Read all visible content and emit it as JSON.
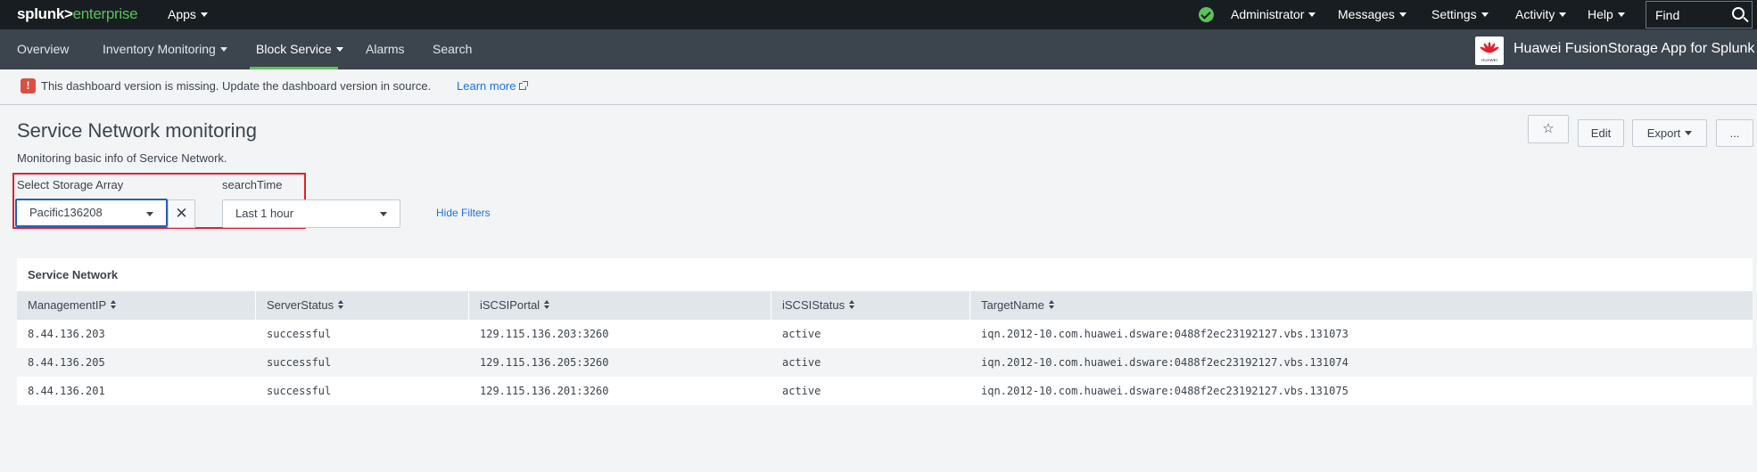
{
  "topbar": {
    "logo_main": "splunk>",
    "logo_sub": "enterprise",
    "apps_label": "Apps",
    "nav": [
      {
        "label": "Administrator"
      },
      {
        "label": "Messages"
      },
      {
        "label": "Settings"
      },
      {
        "label": "Activity"
      },
      {
        "label": "Help"
      }
    ],
    "find_placeholder": "Find",
    "status": "ok"
  },
  "appbar": {
    "tabs": [
      {
        "label": "Overview"
      },
      {
        "label": "Inventory Monitoring"
      },
      {
        "label": "Block Service"
      },
      {
        "label": "Alarms"
      },
      {
        "label": "Search"
      }
    ],
    "active_tab": "Block Service",
    "app_title": "Huawei FusionStorage App for Splunk",
    "logo_text": "HUAWEI"
  },
  "alert": {
    "icon": "!",
    "message": "This dashboard version is missing. Update the dashboard version in source.",
    "link": "Learn more"
  },
  "page": {
    "title": "Service Network monitoring",
    "description": "Monitoring basic info of Service Network.",
    "edit_label": "Edit",
    "export_label": "Export",
    "more_label": "...",
    "star_icon": "☆"
  },
  "filters": {
    "storage_label": "Select Storage Array",
    "storage_value": "Pacific136208",
    "time_label": "searchTime",
    "time_value": "Last 1 hour",
    "clear_icon": "✕",
    "hide_filters": "Hide Filters"
  },
  "panel": {
    "title": "Service Network",
    "columns": [
      "ManagementIP",
      "ServerStatus",
      "iSCSIPortal",
      "iSCSIStatus",
      "TargetName"
    ],
    "rows": [
      [
        "8.44.136.203",
        "successful",
        "129.115.136.203:3260",
        "active",
        "iqn.2012-10.com.huawei.dsware:0488f2ec23192127.vbs.131073"
      ],
      [
        "8.44.136.205",
        "successful",
        "129.115.136.205:3260",
        "active",
        "iqn.2012-10.com.huawei.dsware:0488f2ec23192127.vbs.131074"
      ],
      [
        "8.44.136.201",
        "successful",
        "129.115.136.201:3260",
        "active",
        "iqn.2012-10.com.huawei.dsware:0488f2ec23192127.vbs.131075"
      ]
    ]
  },
  "colors": {
    "topbar_bg": "#171d21",
    "appbar_bg": "#3c444d",
    "accent_green": "#5cc05c",
    "alert_red": "#dc4e41",
    "highlight_red": "#e2202d",
    "highlight_blue": "#1e64b4",
    "link_blue": "#1a73e8"
  }
}
